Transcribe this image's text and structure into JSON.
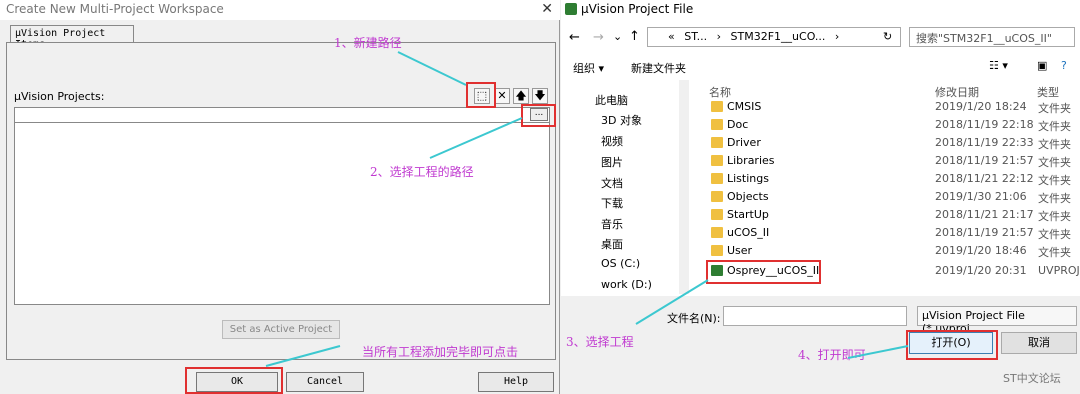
{
  "left": {
    "title": "Create New Multi-Project Workspace",
    "tab": "µVision Project Items",
    "projects_label": "µVision Projects:",
    "set_active": "Set as Active Project",
    "ok": "OK",
    "cancel": "Cancel",
    "help": "Help",
    "tool_new": "⬚",
    "tool_delete": "✕",
    "tool_up": "🡅",
    "tool_down": "🡇",
    "browse": "..."
  },
  "notes": {
    "n1": "1、新建路径",
    "n2": "2、选择工程的路径",
    "n3": "3、选择工程",
    "n4": "4、打开即可",
    "n5": "当所有工程添加完毕即可点击"
  },
  "right": {
    "title": "µVision Project File",
    "addr_parts": [
      "«",
      "ST...",
      "›",
      "STM32F1__uCO...",
      "›"
    ],
    "search_placeholder": "搜索\"STM32F1__uCOS_II\"",
    "organize": "组织 ▾",
    "new_folder": "新建文件夹",
    "tree": [
      "此电脑",
      "3D 对象",
      "视频",
      "图片",
      "文档",
      "下载",
      "音乐",
      "桌面",
      "OS (C:)",
      "work (D:)"
    ],
    "headers": {
      "name": "名称",
      "date": "修改日期",
      "type": "类型"
    },
    "rows": [
      {
        "name": "CMSIS",
        "date": "2019/1/20 18:24",
        "type": "文件夹"
      },
      {
        "name": "Doc",
        "date": "2018/11/19 22:18",
        "type": "文件夹"
      },
      {
        "name": "Driver",
        "date": "2018/11/19 22:33",
        "type": "文件夹"
      },
      {
        "name": "Libraries",
        "date": "2018/11/19 21:57",
        "type": "文件夹"
      },
      {
        "name": "Listings",
        "date": "2018/11/21 22:12",
        "type": "文件夹"
      },
      {
        "name": "Objects",
        "date": "2019/1/30 21:06",
        "type": "文件夹"
      },
      {
        "name": "StartUp",
        "date": "2018/11/21 21:17",
        "type": "文件夹"
      },
      {
        "name": "uCOS_II",
        "date": "2018/11/19 21:57",
        "type": "文件夹"
      },
      {
        "name": "User",
        "date": "2019/1/20 18:46",
        "type": "文件夹"
      },
      {
        "name": "Osprey__uCOS_II",
        "date": "2019/1/20 20:31",
        "type": "UVPROJ"
      }
    ],
    "filename_label": "文件名(N):",
    "filter": "µVision Project File (*.uvproj",
    "open": "打开(O)",
    "cancel": "取消",
    "watermark": "ST中文论坛"
  },
  "colors": {
    "annotation": "#c03ad0",
    "highlight": "#e03030",
    "arrow": "#3cc8d0"
  }
}
